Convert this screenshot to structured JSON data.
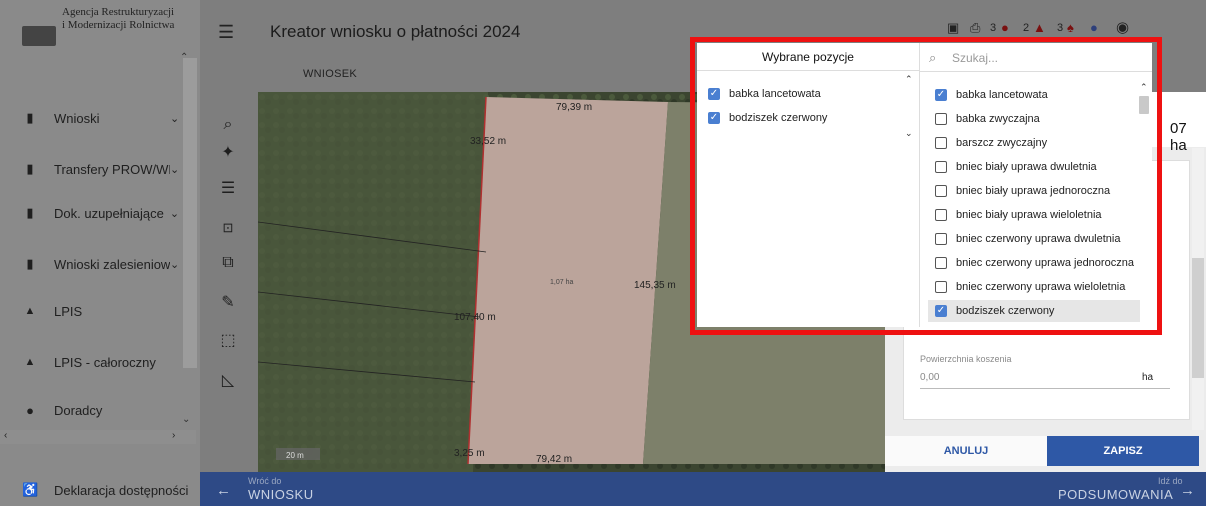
{
  "sidebar": {
    "org_line1": "Agencja Restrukturyzacji",
    "org_line2": "i Modernizacji Rolnictwa",
    "items": [
      {
        "label": "Wnioski",
        "icon": "clipboard-icon"
      },
      {
        "label": "Transfery PROW/WPR",
        "icon": "clipboard-icon"
      },
      {
        "label": "Dok. uzupełniające",
        "icon": "clipboard-icon"
      },
      {
        "label": "Wnioski zalesieniowe",
        "icon": "clipboard-icon"
      },
      {
        "label": "LPIS",
        "icon": "mountain-icon"
      },
      {
        "label": "LPIS - całoroczny",
        "icon": "mountain-icon"
      },
      {
        "label": "Doradcy",
        "icon": "person-icon"
      },
      {
        "label": "Deklaracja dostępności",
        "icon": "accessibility-icon"
      }
    ]
  },
  "header": {
    "title": "Kreator wniosku o płatności 2024",
    "tab": "WNIOSEK",
    "error_count": "3",
    "warning_count": "2",
    "notice_count": "3"
  },
  "map": {
    "labels": [
      "79,39 m",
      "33,52 m",
      "1,07 ha",
      "145,35 m",
      "107,40 m",
      "3,25 m",
      "79,42 m",
      "20 m"
    ]
  },
  "form": {
    "area_value": "07 ha",
    "mowing_label": "Powierzchnia koszenia",
    "mowing_value": "0,00",
    "mowing_unit": "ha",
    "cancel_label": "ANULUJ",
    "save_label": "ZAPISZ"
  },
  "popup": {
    "selected_heading": "Wybrane pozycje",
    "search_placeholder": "Szukaj...",
    "selected": [
      "babka lancetowata",
      "bodziszek czerwony"
    ],
    "options": [
      {
        "label": "babka lancetowata",
        "checked": true
      },
      {
        "label": "babka zwyczajna",
        "checked": false
      },
      {
        "label": "barszcz zwyczajny",
        "checked": false
      },
      {
        "label": "bniec biały uprawa dwuletnia",
        "checked": false
      },
      {
        "label": "bniec biały uprawa jednoroczna",
        "checked": false
      },
      {
        "label": "bniec biały uprawa wieloletnia",
        "checked": false
      },
      {
        "label": "bniec czerwony uprawa dwuletnia",
        "checked": false
      },
      {
        "label": "bniec czerwony uprawa jednoroczna",
        "checked": false
      },
      {
        "label": "bniec czerwony uprawa wieloletnia",
        "checked": false
      },
      {
        "label": "bodziszek czerwony",
        "checked": true
      }
    ]
  },
  "footer": {
    "back_small": "Wróć do",
    "back_big": "WNIOSKU",
    "next_small": "Idź do",
    "next_big": "PODSUMOWANIA"
  },
  "colors": {
    "accent_blue": "#2e58a6",
    "highlight_red": "#ee1111",
    "checkbox_blue": "#4a7fd1"
  }
}
